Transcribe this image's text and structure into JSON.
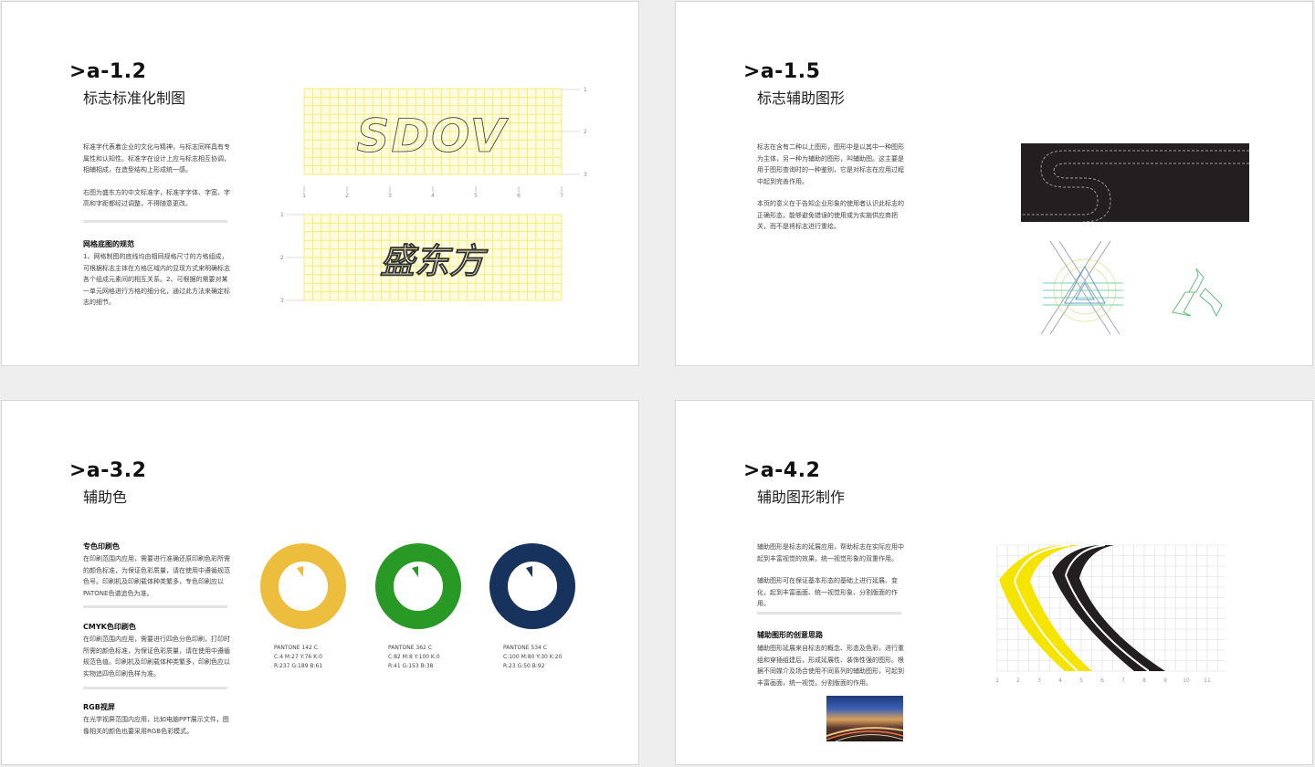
{
  "panels": [
    {
      "code": ">a-1.2",
      "title": "标志标准化制图",
      "intro": [
        "标准字代表着企业的文化与精神，与标志同样具有专属性和认知性。标准字在设计上应与标志相互协调，相辅相成，在造型结构上形成统一感。",
        "右图为盛东方的中文标准字，标准字字体、字宽、字高和字距都经过调整，不得随意更改。"
      ],
      "sub_heading": "网格底图的规范",
      "sub_text": "1、网格制图的底线均由相同规格尺寸的方格组成，可根据标志主体在方格区域内的显现方式来明确标志各个组成元素间的相互关系。2、可根据的需要对某一单元网格进行方格的细分化，通过此方法来确定标志的细节。",
      "logo_text": "SDOV",
      "logo_text_cn": "盛东方",
      "grid_top_x_ticks": [
        "1",
        "2",
        "3",
        "4",
        "5",
        "6",
        "7"
      ],
      "grid_top_y_ticks": [
        "1",
        "2",
        "3"
      ],
      "grid_bottom_y_ticks": [
        "1",
        "2",
        "3"
      ]
    },
    {
      "code": ">a-1.5",
      "title": "标志辅助图形",
      "intro": [
        "标志在含有二种以上图形，图形中是以其中一种图形为主体，另一种为辅助的图形，叫辅助图。这主要是用于图形查询时的一种鉴别，它是对标志在应用过程中起到完善作用。",
        "本页的意义在于告知企业形象的使用者认识此标志的正确形态，能够避免错误的使用或为实施供应商把关，而不是将标志进行重绘。"
      ]
    },
    {
      "code": ">a-3.2",
      "title": "辅助色",
      "sections": [
        {
          "heading": "专色印刷色",
          "text": "在印刷范围内应用，需要进行准确还原印刷色彩所需的颜色标准，为保证色彩质量，请在使用中遵循规范色号。印刷机及印刷载体种类繁多，专色印刷应以PATONE色谱追色为准。"
        },
        {
          "heading": "CMYK色印刷色",
          "text": "在印刷范围内应用，需要进行四色分色印刷，打印时所需的颜色标准，为保证色彩质量，请在使用中遵循规范色值。印刷机及印刷载体种类繁多，印刷色应以实物追四色印刷色样为准。"
        },
        {
          "heading": "RGB视屏",
          "text": "在光学视屏范围内应用，比如电脑PPT展示文件，图像相关的颜色也要采用RGB色彩模式。"
        }
      ],
      "swatches": [
        {
          "name": "PANTONE 142 C",
          "cmyk": "C:4  M:27  Y:76  K:0",
          "rgb": "R:237  G:189  B:61",
          "color": "#EDBD3D"
        },
        {
          "name": "PANTONE 362 C",
          "cmyk": "C:82  M:8  Y:100  K:0",
          "rgb": "R:41  G:153  B:38",
          "color": "#299926"
        },
        {
          "name": "PANTONE 534 C",
          "cmyk": "C:100  M:80  Y:30  K:20",
          "rgb": "R:23  G:50  B:92",
          "color": "#17325C"
        }
      ]
    },
    {
      "code": ">a-4.2",
      "title": "辅助图形制作",
      "intro": [
        "辅助图形是标志的延展应用，帮助标志在实际应用中起到丰富视觉的效果，统一视觉形象的双重作用。",
        "辅助图形可在保证基本形态的基础上进行延展、变化，起到丰富画面、统一视觉形象、分割版面的作用。"
      ],
      "sub_heading": "辅助图形的创意思路",
      "sub_text": "辅助图形延展来自标志的概念、形态及色彩，进行重组和穿插组建后，形成延展性、装饰性强的图形。根据不同媒介及场合使用不同系列的辅助图形，可起到丰富画面，统一视觉，分割版面的作用。",
      "grid_x_ticks": [
        "1",
        "2",
        "3",
        "4",
        "5",
        "6",
        "7",
        "8",
        "9",
        "10",
        "11"
      ],
      "grid_y_ticks": [
        "1",
        "2",
        "3",
        "4",
        "5",
        "6",
        "7"
      ]
    }
  ],
  "colors": {
    "grid_yellow": "#F5EC7A",
    "grid_bg": "#FEFCE0",
    "accent_yellow": "#F5E400",
    "dark": "#231F20"
  }
}
